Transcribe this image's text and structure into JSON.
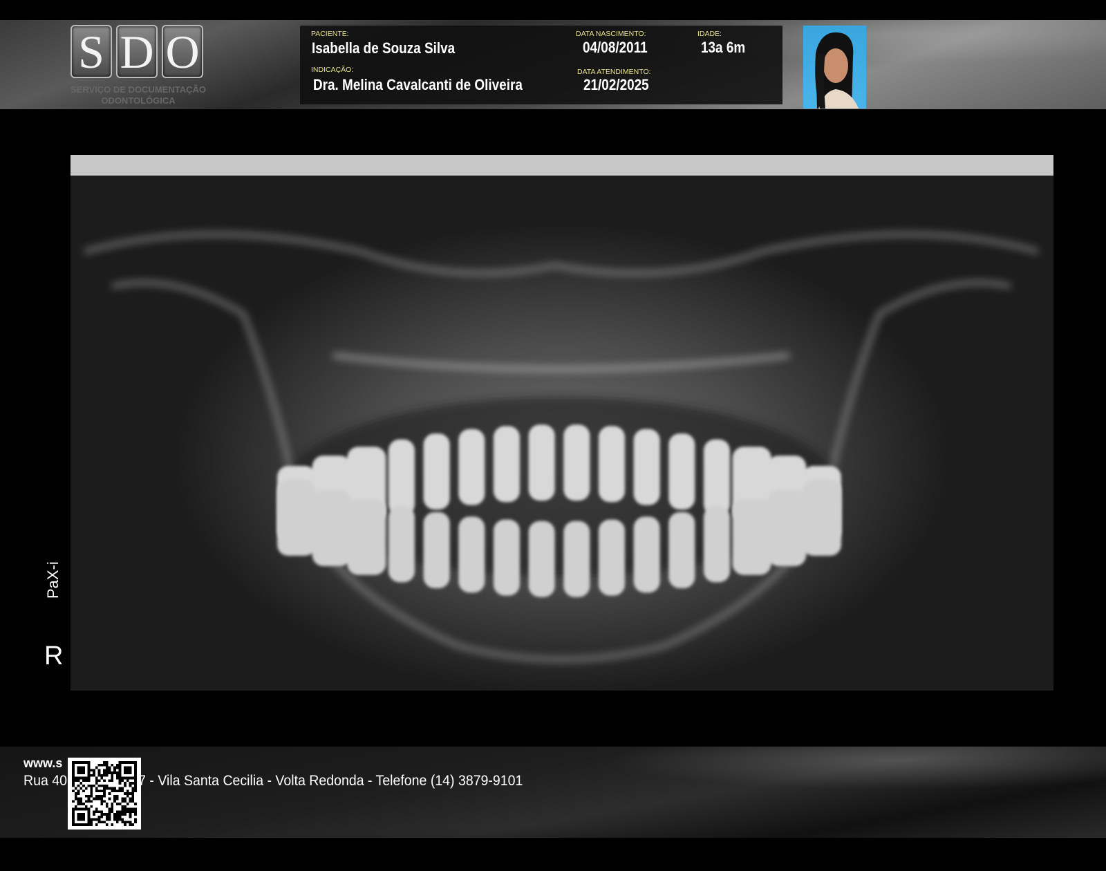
{
  "header": {
    "logo": {
      "letters": [
        "S",
        "D",
        "O"
      ],
      "subtitle": "SERVIÇO DE DOCUMENTAÇÃO ODONTOLÓGICA"
    },
    "patient_label": "PACIENTE:",
    "patient_name": "Isabella de Souza Silva",
    "indication_label": "INDICAÇÃO:",
    "indication_value": "Dra. Melina Cavalcanti de Oliveira",
    "birth_label": "DATA NASCIMENTO:",
    "birth_value": "04/08/2011",
    "age_label": "IDADE:",
    "age_value": "13a 6m",
    "visit_label": "DATA ATENDIMENTO:",
    "visit_value": "21/02/2025"
  },
  "image": {
    "device_label": "PaX-i",
    "side_marker": "R"
  },
  "footer": {
    "website": "www.s",
    "address": "Rua 40 ... a 506/507 - Vila Santa Cecilia - Volta Redonda  -  Telefone (14) 3879-9101"
  }
}
